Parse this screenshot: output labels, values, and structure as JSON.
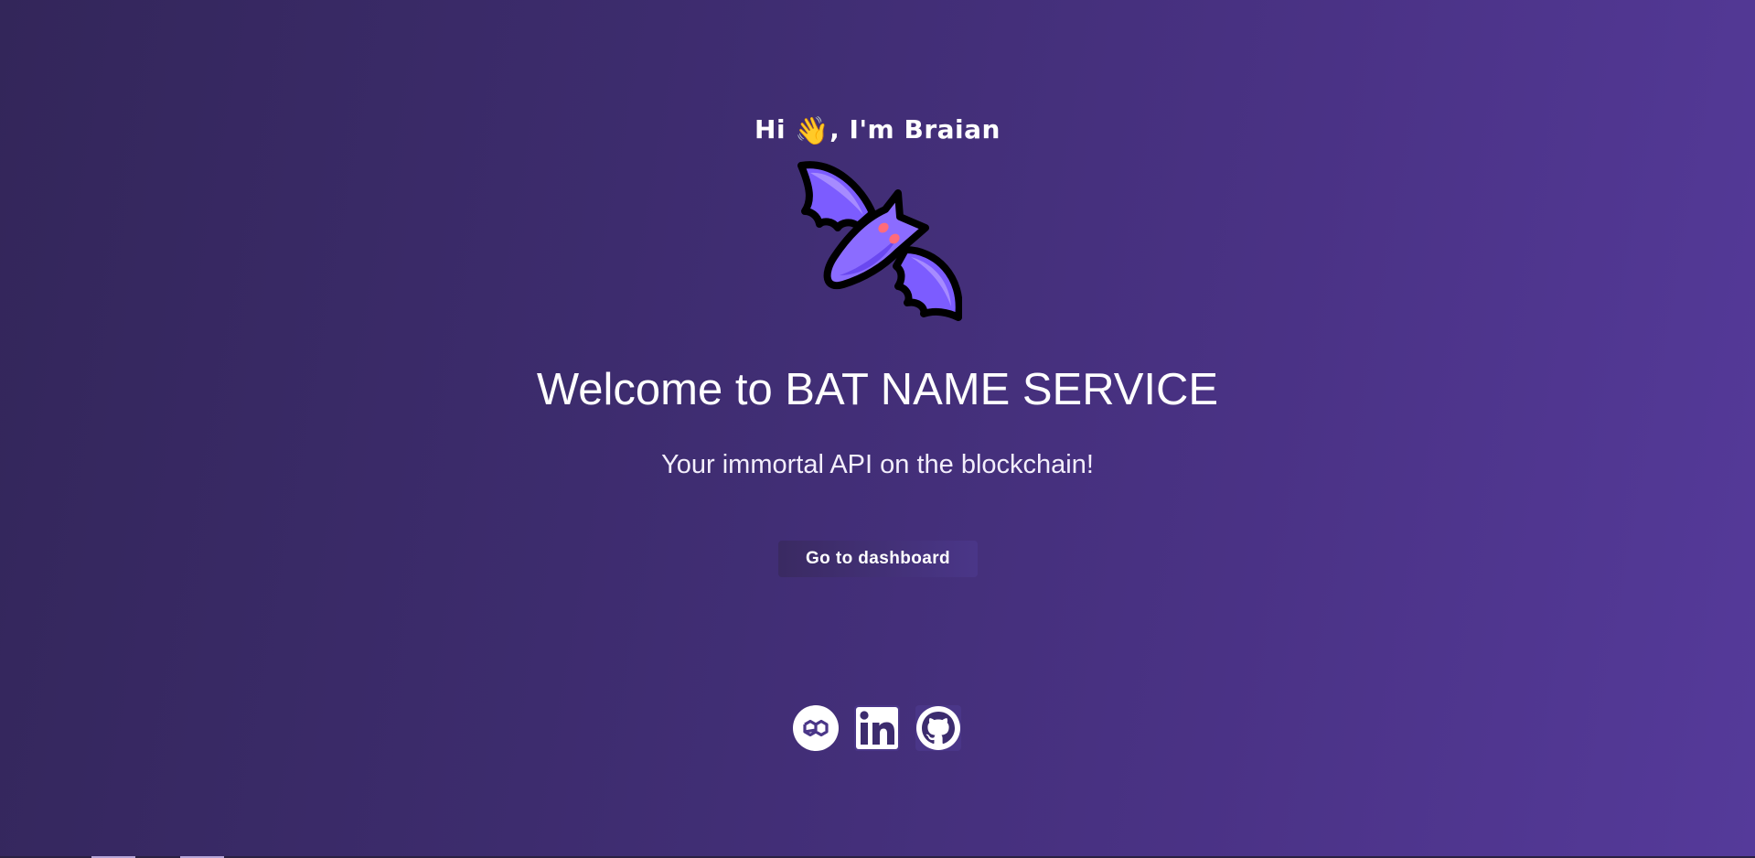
{
  "hero": {
    "greeting_prefix": "Hi ",
    "greeting_emoji": "👋",
    "greeting_suffix": ", I'm Braian",
    "title": "Welcome to BAT NAME SERVICE",
    "subtitle": "Your immortal API on the blockchain!",
    "cta_label": "Go to dashboard",
    "logo_icon": "bat-icon"
  },
  "socials": [
    {
      "name": "polygon",
      "icon": "polygon-icon"
    },
    {
      "name": "linkedin",
      "icon": "linkedin-icon"
    },
    {
      "name": "github",
      "icon": "github-icon"
    }
  ],
  "colors": {
    "background_start": "#33265a",
    "background_end": "#553a9a",
    "bat_body": "#7c5cff",
    "bat_wing": "#9a7dff",
    "bat_cheek": "#ff6b7a",
    "button_start": "#3a2a62",
    "button_end": "#4a3688"
  }
}
